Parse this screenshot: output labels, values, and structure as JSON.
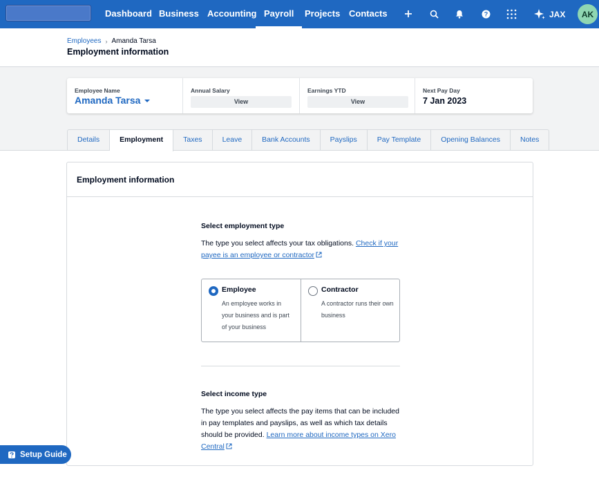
{
  "topbar": {
    "nav": [
      "Dashboard",
      "Business",
      "Accounting",
      "Payroll",
      "Projects",
      "Contacts"
    ],
    "active_nav": "Payroll",
    "jax_label": "JAX",
    "avatar_initials": "AK",
    "accent_color": "#1f68c1"
  },
  "header": {
    "breadcrumb": {
      "parent": "Employees",
      "current": "Amanda Tarsa"
    },
    "title": "Employment information"
  },
  "summary": {
    "employee_name_label": "Employee Name",
    "employee_name": "Amanda Tarsa",
    "annual_salary_label": "Annual Salary",
    "annual_salary_button": "View",
    "earnings_ytd_label": "Earnings YTD",
    "earnings_ytd_button": "View",
    "next_pay_day_label": "Next Pay Day",
    "next_pay_day": "7 Jan 2023"
  },
  "tabs": [
    "Details",
    "Employment",
    "Taxes",
    "Leave",
    "Bank Accounts",
    "Payslips",
    "Pay Template",
    "Opening Balances",
    "Notes"
  ],
  "active_tab": "Employment",
  "panel": {
    "title": "Employment information",
    "employment_type": {
      "title": "Select employment type",
      "text": "The type you select affects your tax obligations.",
      "link": "Check if your payee is an employee or contractor",
      "options": [
        {
          "label": "Employee",
          "description": "An employee works in your business and is part of your business",
          "selected": true
        },
        {
          "label": "Contractor",
          "description": "A contractor runs their own business",
          "selected": false
        }
      ]
    },
    "income_type": {
      "title": "Select income type",
      "text": "The type you select affects the pay items that can be included in pay templates and payslips, as well as which tax details should be provided.",
      "link": "Learn more about income types on Xero Central"
    }
  },
  "setup_guide": {
    "label": "Setup Guide"
  }
}
